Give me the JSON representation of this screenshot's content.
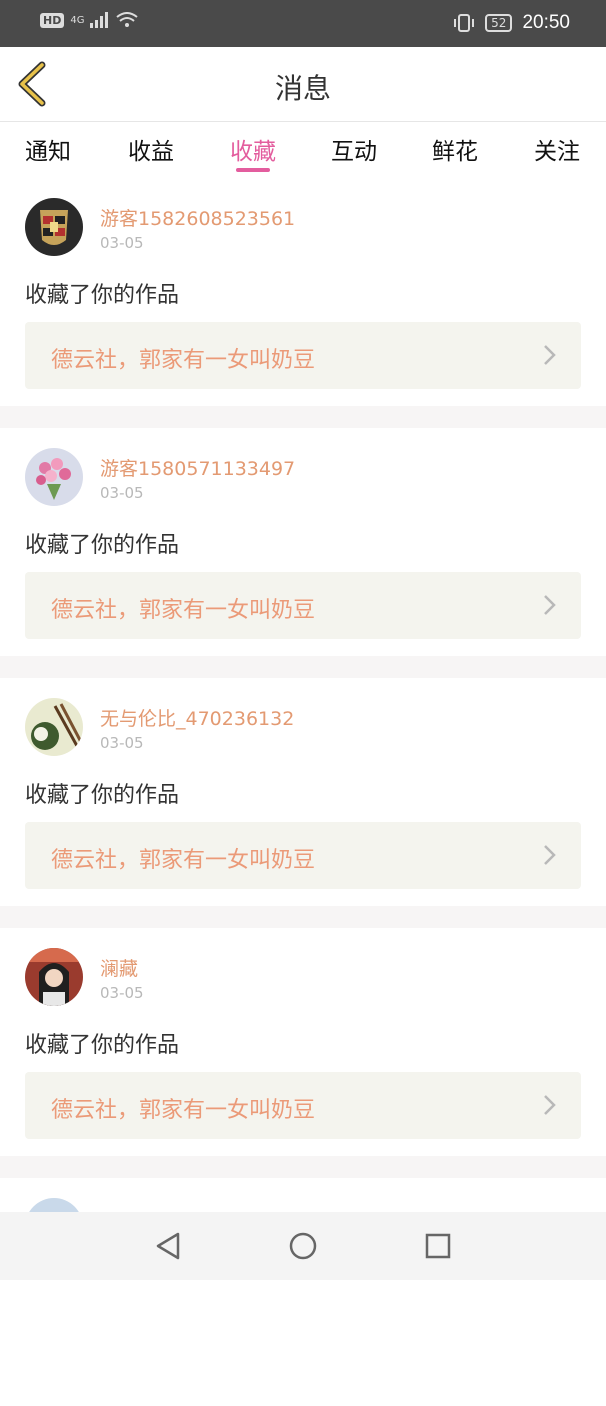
{
  "status": {
    "hd": "HD",
    "network": "4G",
    "battery": "52",
    "time": "20:50"
  },
  "header": {
    "title": "消息"
  },
  "tabs": [
    "通知",
    "收益",
    "收藏",
    "互动",
    "鲜花",
    "关注"
  ],
  "active_tab": "收藏",
  "notifications": [
    {
      "username": "游客1582608523561",
      "date": "03-05",
      "action": "收藏了你的作品",
      "work_title": "德云社，郭家有一女叫奶豆"
    },
    {
      "username": "游客1580571133497",
      "date": "03-05",
      "action": "收藏了你的作品",
      "work_title": "德云社，郭家有一女叫奶豆"
    },
    {
      "username": "无与伦比_470236132",
      "date": "03-05",
      "action": "收藏了你的作品",
      "work_title": "德云社，郭家有一女叫奶豆"
    },
    {
      "username": "澜藏",
      "date": "03-05",
      "action": "收藏了你的作品",
      "work_title": "德云社，郭家有一女叫奶豆"
    }
  ],
  "colors": {
    "accent": "#e35d9e",
    "username": "#e39a72",
    "work_title": "#eb9a78",
    "back_arrow": "#e8c24a"
  }
}
